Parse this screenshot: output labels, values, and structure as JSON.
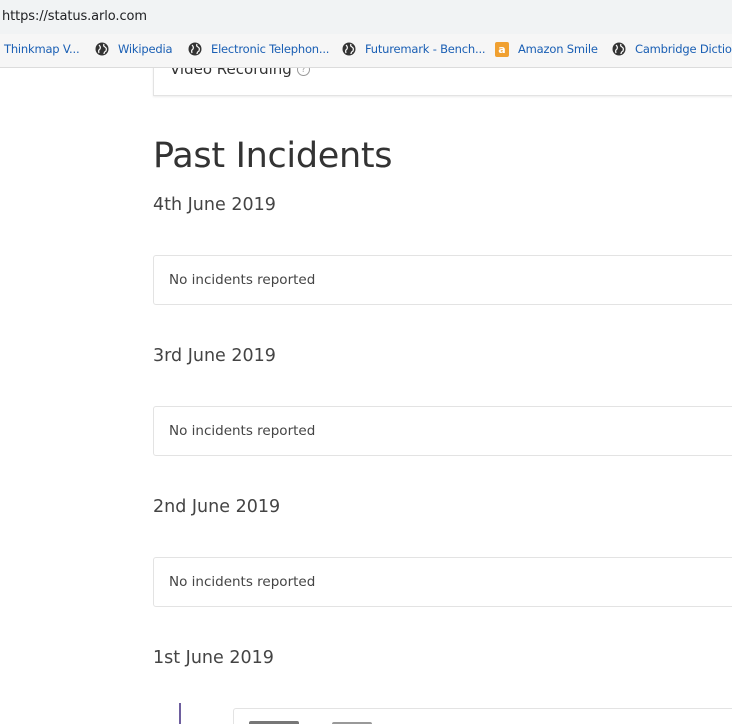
{
  "browser": {
    "url": "https://status.arlo.com",
    "bookmarks": [
      {
        "label": "Thinkmap V...",
        "icon": "none"
      },
      {
        "label": "Wikipedia",
        "icon": "globe-icon"
      },
      {
        "label": "Electronic Telephon...",
        "icon": "globe-icon"
      },
      {
        "label": "Futuremark - Bench...",
        "icon": "globe-icon"
      },
      {
        "label": "Amazon Smile",
        "icon": "amazon-icon",
        "icon_text": "a"
      },
      {
        "label": "Cambridge Diction",
        "icon": "globe-icon"
      }
    ]
  },
  "component": {
    "label": "Video Recording",
    "info_icon": "?"
  },
  "past_incidents": {
    "title": "Past Incidents",
    "days": [
      {
        "date": "4th June 2019",
        "message": "No incidents reported"
      },
      {
        "date": "3rd June 2019",
        "message": "No incidents reported"
      },
      {
        "date": "2nd June 2019",
        "message": "No incidents reported"
      },
      {
        "date": "1st June 2019"
      }
    ]
  },
  "colors": {
    "link": "#1a5fb4",
    "timeline": "#6e5f9e",
    "amazon": "#f0a030"
  }
}
